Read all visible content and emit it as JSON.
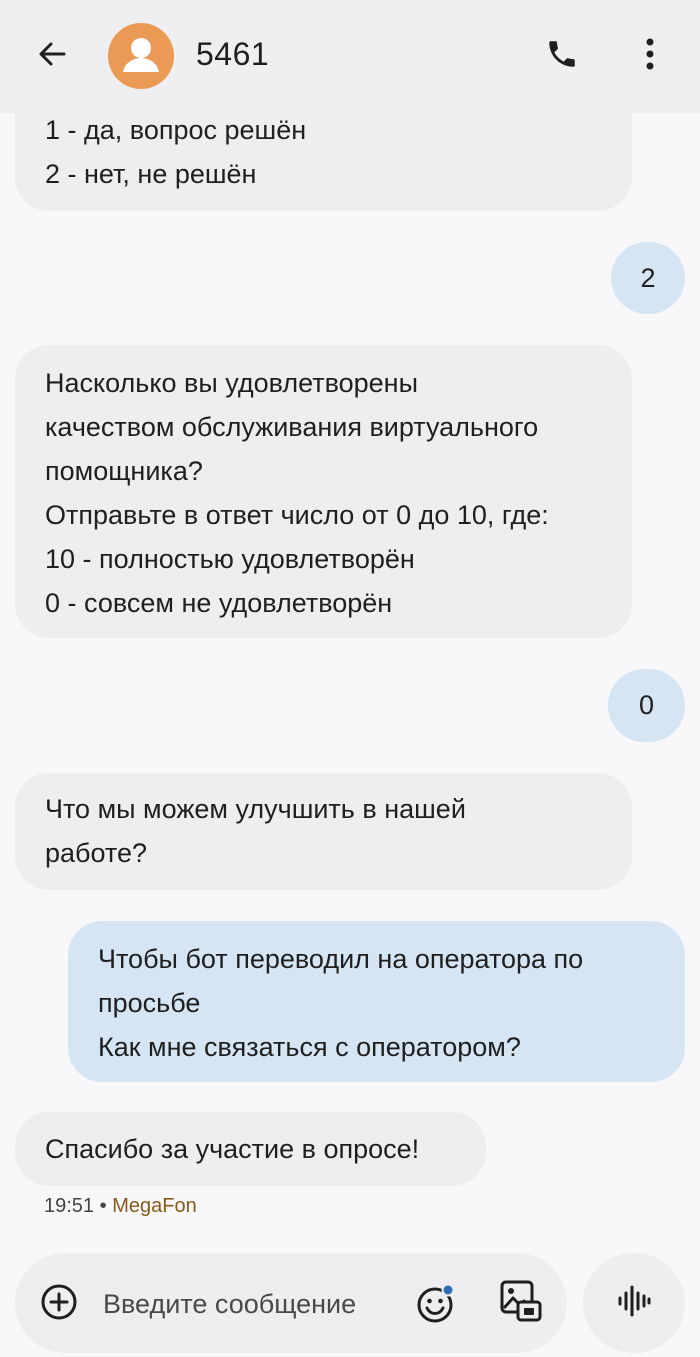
{
  "header": {
    "contact_name": "5461",
    "back_icon": "arrow-back-icon",
    "avatar_color": "#eb9a55",
    "call_icon": "phone-icon",
    "menu_icon": "more-vert-icon"
  },
  "messages": [
    {
      "direction": "incoming",
      "lines": [
        "1 - да, вопрос решён",
        "2 - нет, не решён"
      ]
    },
    {
      "direction": "outgoing",
      "lines": [
        "2"
      ]
    },
    {
      "direction": "incoming",
      "lines": [
        "Насколько вы удовлетворены",
        "качеством обслуживания виртуального",
        "помощника?",
        "Отправьте в ответ число от 0 до 10, где:",
        "10 - полностью удовлетворён",
        "0 - совсем не удовлетворён"
      ]
    },
    {
      "direction": "outgoing",
      "lines": [
        "0"
      ]
    },
    {
      "direction": "incoming",
      "lines": [
        "Что мы можем улучшить в нашей",
        "работе?"
      ]
    },
    {
      "direction": "outgoing",
      "lines": [
        "Чтобы бот переводил на оператора по",
        "просьбе",
        "Как мне связаться с оператором?"
      ]
    },
    {
      "direction": "incoming",
      "lines": [
        "Спасибо за участие в опросе!"
      ]
    }
  ],
  "last_meta": {
    "time": "19:51",
    "separator": "•",
    "carrier": "MegaFon"
  },
  "composer": {
    "placeholder": "Введите сообщение",
    "add_icon": "add-circle-icon",
    "emoji_icon": "emoji-icon",
    "gallery_icon": "gallery-icon",
    "voice_icon": "voice-waveform-icon"
  },
  "colors": {
    "incoming_bubble": "#eeeef1",
    "outgoing_bubble": "#d6e5f4",
    "background": "#f8f8fb",
    "header": "#efeff2",
    "accent_dot": "#2f6db5"
  }
}
